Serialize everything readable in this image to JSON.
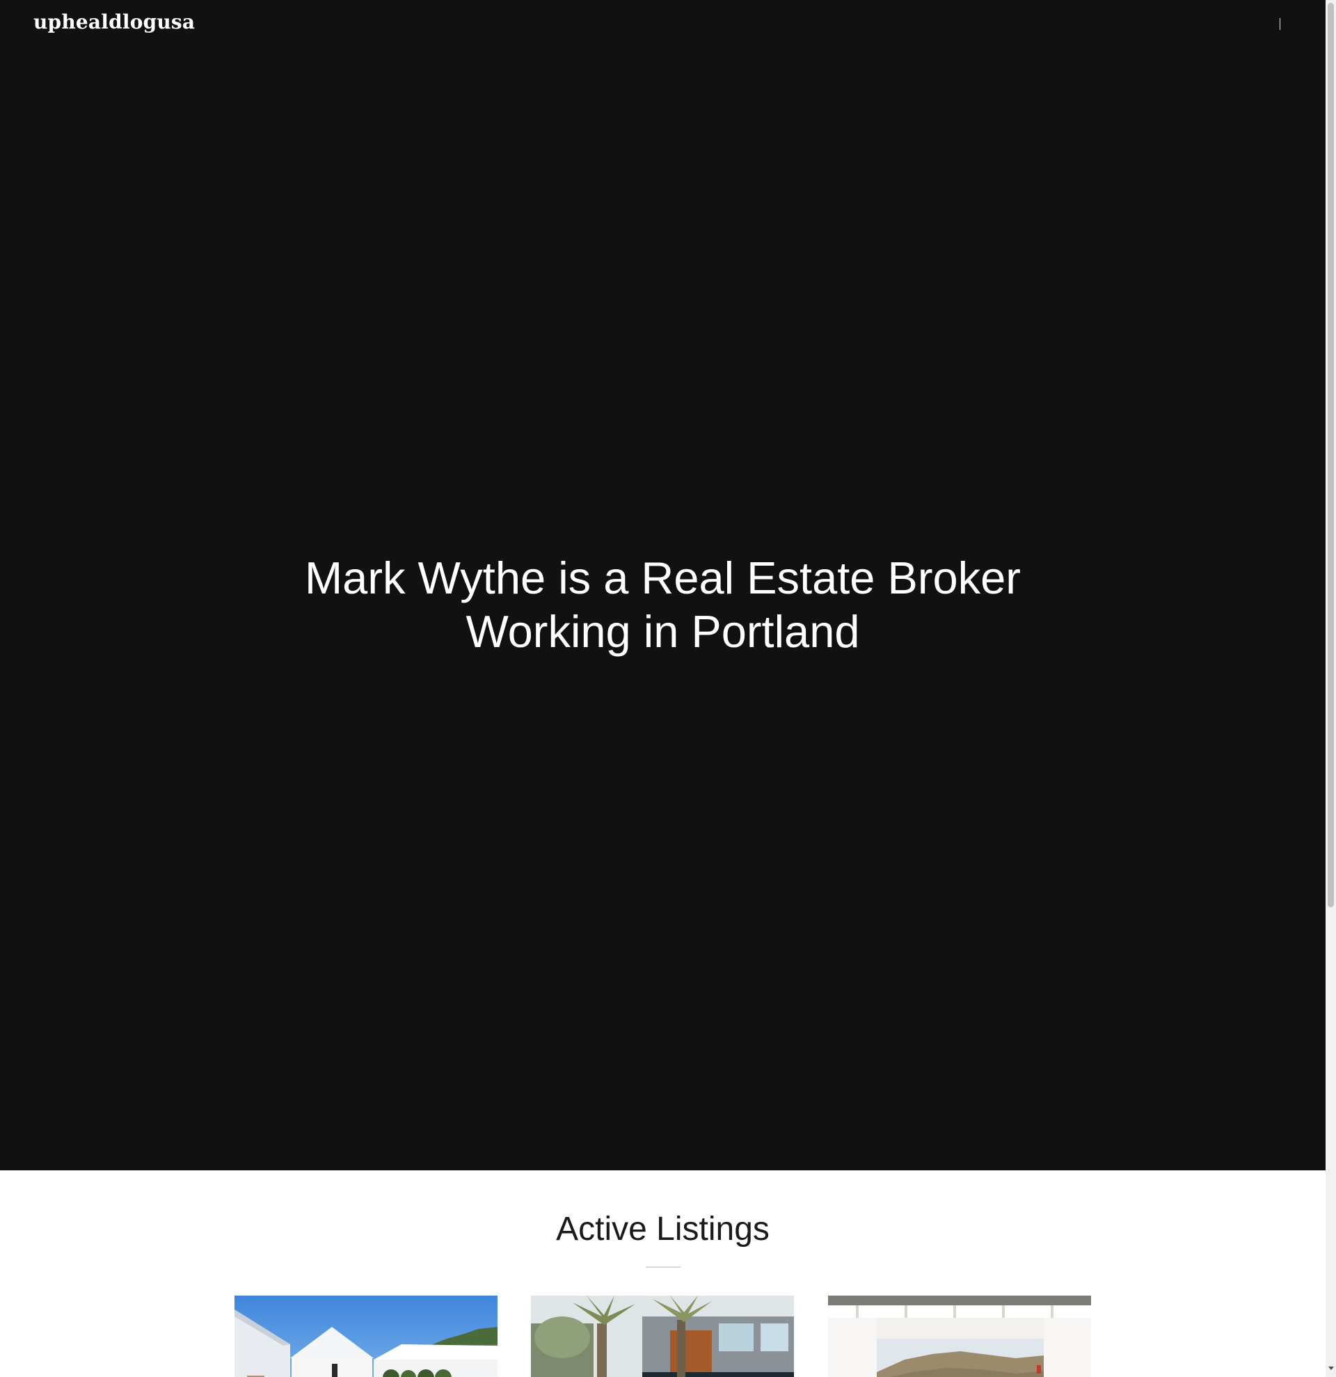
{
  "header": {
    "logo_text": "uphealdlogusa"
  },
  "hero": {
    "title_line1": "Mark Wythe is a Real Estate Broker",
    "title_line2": "Working in Portland"
  },
  "listings": {
    "heading": "Active Listings",
    "cards": [
      {
        "image": "white-farmhouse-photo"
      },
      {
        "image": "palm-tree-house-photo"
      },
      {
        "image": "hillside-window-view-photo"
      }
    ]
  },
  "colors": {
    "hero_background": "#111112",
    "hero_text": "#ffffff",
    "section_background": "#ffffff",
    "heading_text": "#1b1b1b"
  }
}
